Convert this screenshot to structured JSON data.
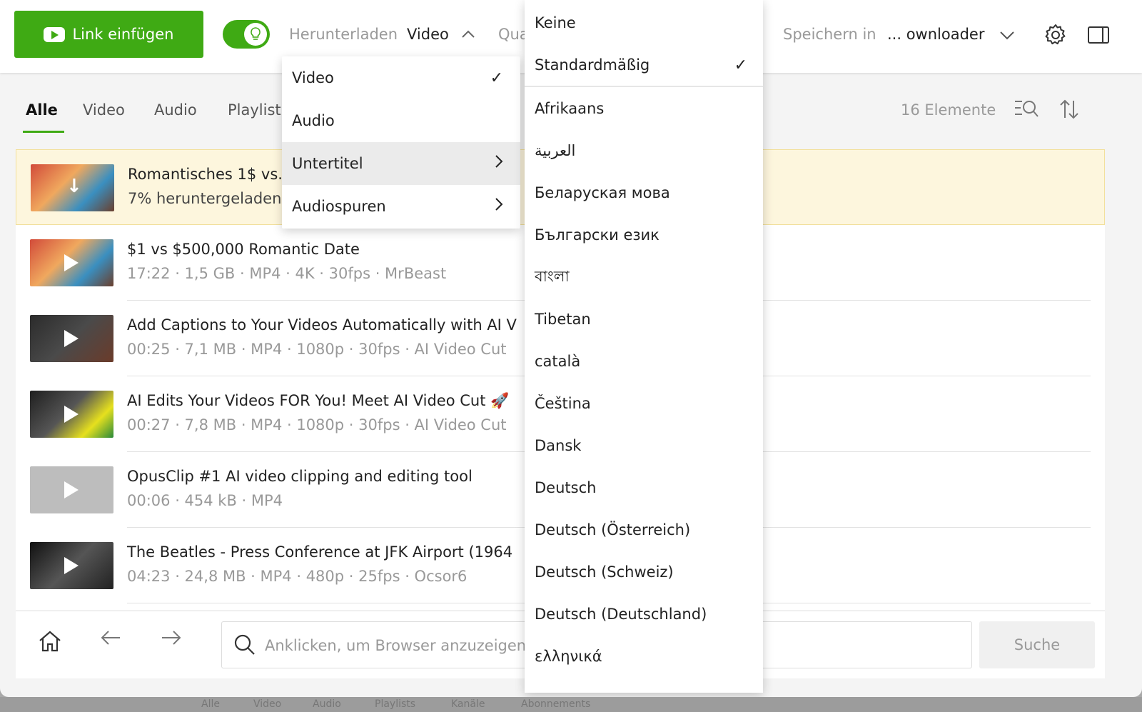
{
  "toolbar": {
    "paste_label": "Link einfügen",
    "download_label": "Herunterladen",
    "download_value": "Video",
    "quality_label_partial": "Qua",
    "save_label": "Speichern in",
    "save_value": "... ownloader"
  },
  "tabs": [
    {
      "label": "Alle",
      "active": true
    },
    {
      "label": "Video"
    },
    {
      "label": "Audio"
    },
    {
      "label": "Playlist"
    }
  ],
  "item_count": "16 Elemente",
  "items": [
    {
      "title": "Romantisches 1$ vs.",
      "meta": "7% heruntergeladen",
      "state": "downloading"
    },
    {
      "title": "$1 vs $500,000 Romantic Date",
      "meta": "17:22 · 1,5 GB · MP4 · 4K · 30fps · MrBeast"
    },
    {
      "title": "Add Captions to Your Videos Automatically with AI V",
      "meta": "00:25 · 7,1 MB · MP4 · 1080p · 30fps · AI Video Cut"
    },
    {
      "title": "AI Edits Your Videos FOR You! Meet AI Video Cut 🚀",
      "meta": "00:27 · 7,8 MB · MP4 · 1080p · 30fps · AI Video Cut"
    },
    {
      "title": "OpusClip #1 AI video clipping and editing tool",
      "meta": "00:06 · 454 kB · MP4"
    },
    {
      "title": "The Beatles - Press Conference at JFK Airport (1964",
      "meta": "04:23 · 24,8 MB · MP4 · 480p · 25fps · Ocsor6"
    }
  ],
  "browser": {
    "placeholder": "Anklicken, um Browser anzuzeigen",
    "search_label": "Suche"
  },
  "download_menu": [
    {
      "label": "Video",
      "checked": true
    },
    {
      "label": "Audio"
    },
    {
      "label": "Untertitel",
      "submenu": true,
      "highlighted": true
    },
    {
      "label": "Audiospuren",
      "submenu": true
    }
  ],
  "subtitle_menu": [
    {
      "label": "Keine"
    },
    {
      "label": "Standardmäßig",
      "checked": true
    },
    {
      "label": "Afrikaans"
    },
    {
      "label": "العربية"
    },
    {
      "label": "Беларуская мова"
    },
    {
      "label": "Български език"
    },
    {
      "label": "বাংলা"
    },
    {
      "label": "Tibetan"
    },
    {
      "label": "català"
    },
    {
      "label": "Čeština"
    },
    {
      "label": "Dansk"
    },
    {
      "label": "Deutsch"
    },
    {
      "label": "Deutsch (Österreich)"
    },
    {
      "label": "Deutsch (Schweiz)"
    },
    {
      "label": "Deutsch (Deutschland)"
    },
    {
      "label": "ελληνικά"
    }
  ],
  "background_tabs": [
    "Alle",
    "Video",
    "Audio",
    "Playlists",
    "Kanäle",
    "Abonnements"
  ],
  "colors": {
    "accent": "#3faa14",
    "active_row": "#fdf6dd"
  },
  "icons": {
    "check": "✓",
    "submenu": "›"
  }
}
